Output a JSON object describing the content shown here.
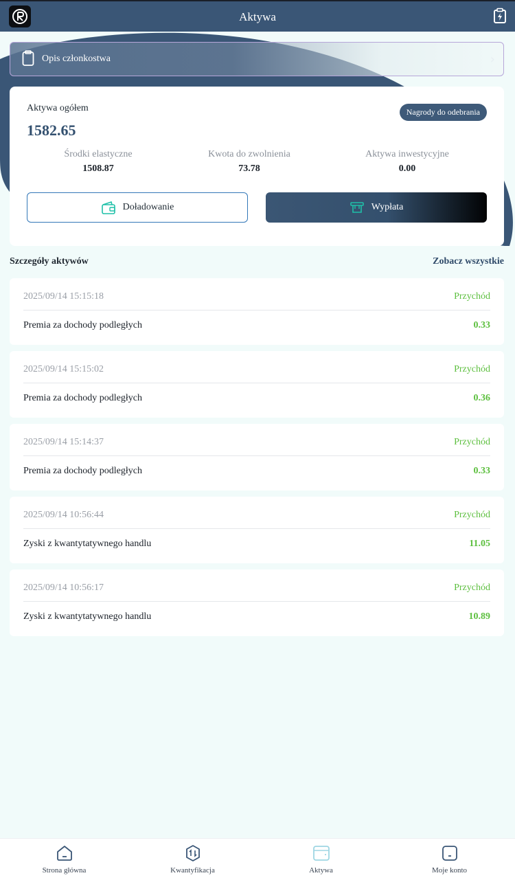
{
  "header": {
    "title": "Aktywa"
  },
  "membership": {
    "label": "Opis członkostwa"
  },
  "assets": {
    "total_label": "Aktywa ogółem",
    "total_value": "1582.65",
    "rewards_badge": "Nagrody do odebrania",
    "stats": [
      {
        "label": "Środki elastyczne",
        "value": "1508.87"
      },
      {
        "label": "Kwota do zwolnienia",
        "value": "73.78"
      },
      {
        "label": "Aktywa inwestycyjne",
        "value": "0.00"
      }
    ],
    "deposit_label": "Doładowanie",
    "withdraw_label": "Wypłata"
  },
  "details": {
    "title": "Szczegóły aktywów",
    "see_all": "Zobacz wszystkie",
    "transactions": [
      {
        "date": "2025/09/14 15:15:18",
        "type": "Przychód",
        "desc": "Premia za dochody podległych",
        "amount": "0.33"
      },
      {
        "date": "2025/09/14 15:15:02",
        "type": "Przychód",
        "desc": "Premia za dochody podległych",
        "amount": "0.36"
      },
      {
        "date": "2025/09/14 15:14:37",
        "type": "Przychód",
        "desc": "Premia za dochody podległych",
        "amount": "0.33"
      },
      {
        "date": "2025/09/14 10:56:44",
        "type": "Przychód",
        "desc": "Zyski z kwantytatywnego handlu",
        "amount": "11.05"
      },
      {
        "date": "2025/09/14 10:56:17",
        "type": "Przychód",
        "desc": "Zyski z kwantytatywnego handlu",
        "amount": "10.89"
      }
    ]
  },
  "nav": {
    "items": [
      {
        "label": "Strona główna",
        "icon": "home-icon"
      },
      {
        "label": "Kwantyfikacja",
        "icon": "quantify-icon"
      },
      {
        "label": "Aktywa",
        "icon": "wallet-icon"
      },
      {
        "label": "Moje konto",
        "icon": "account-icon"
      }
    ],
    "active_index": 2
  },
  "colors": {
    "brand": "#3a5676",
    "income": "#5cbf3e",
    "accent_teal": "#1fc0a8"
  }
}
